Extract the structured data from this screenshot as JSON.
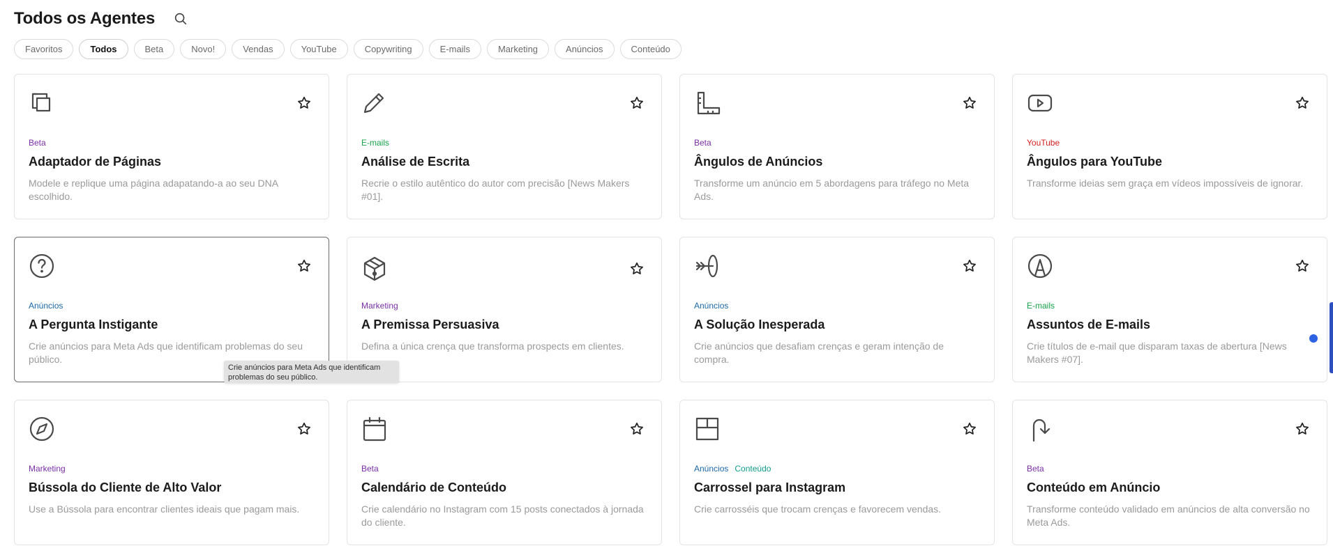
{
  "header": {
    "title": "Todos os Agentes"
  },
  "filters": [
    {
      "label": "Favoritos",
      "active": false
    },
    {
      "label": "Todos",
      "active": true
    },
    {
      "label": "Beta",
      "active": false
    },
    {
      "label": "Novo!",
      "active": false
    },
    {
      "label": "Vendas",
      "active": false
    },
    {
      "label": "YouTube",
      "active": false
    },
    {
      "label": "Copywriting",
      "active": false
    },
    {
      "label": "E-mails",
      "active": false
    },
    {
      "label": "Marketing",
      "active": false
    },
    {
      "label": "Anúncios",
      "active": false
    },
    {
      "label": "Conteúdo",
      "active": false
    }
  ],
  "tag_colors": {
    "Beta": "#7b2fa6",
    "E-mails": "#18a34a",
    "YouTube": "#d32020",
    "Anúncios": "#1c67a8",
    "Marketing": "#7b2fa6",
    "Conteúdo": "#129a8a"
  },
  "cards": [
    {
      "icon": "copy-icon",
      "tags": [
        "Beta"
      ],
      "title": "Adaptador de Páginas",
      "description": "Modele e replique uma página adapatando-a ao seu DNA escolhido."
    },
    {
      "icon": "pencil-icon",
      "tags": [
        "E-mails"
      ],
      "title": "Análise de Escrita",
      "description": "Recrie o estilo autêntico do autor com precisão [News Makers #01]."
    },
    {
      "icon": "ruler-icon",
      "tags": [
        "Beta"
      ],
      "title": "Ângulos de Anúncios",
      "description": "Transforme um anúncio em 5 abordagens para tráfego no Meta Ads."
    },
    {
      "icon": "youtube-icon",
      "tags": [
        "YouTube"
      ],
      "title": "Ângulos para YouTube",
      "description": "Transforme ideias sem graça em vídeos impossíveis de ignorar."
    },
    {
      "icon": "question-circle-icon",
      "tags": [
        "Anúncios"
      ],
      "title": "A Pergunta Instigante",
      "description": "Crie anúncios para Meta Ads que identificam problemas do seu público."
    },
    {
      "icon": "box-icon",
      "tags": [
        "Marketing"
      ],
      "title": "A Premissa Persuasiva",
      "description": "Defina a única crença que transforma prospects em clientes."
    },
    {
      "icon": "target-arrow-icon",
      "tags": [
        "Anúncios"
      ],
      "title": "A Solução Inesperada",
      "description": "Crie anúncios que desafiam crenças e geram intenção de compra."
    },
    {
      "icon": "letter-a-circle-icon",
      "tags": [
        "E-mails"
      ],
      "title": "Assuntos de E-mails",
      "description": "Crie títulos de e-mail que disparam taxas de abertura [News Makers #07]."
    },
    {
      "icon": "compass-icon",
      "tags": [
        "Marketing"
      ],
      "title": "Bússola do Cliente de Alto Valor",
      "description": "Use a Bússola para encontrar clientes ideais que pagam mais."
    },
    {
      "icon": "calendar-icon",
      "tags": [
        "Beta"
      ],
      "title": "Calendário de Conteúdo",
      "description": "Crie calendário no Instagram com 15 posts conectados à jornada do cliente."
    },
    {
      "icon": "layout-grid-icon",
      "tags": [
        "Anúncios",
        "Conteúdo"
      ],
      "title": "Carrossel para Instagram",
      "description": "Crie carrosséis que trocam crenças e favorecem vendas."
    },
    {
      "icon": "arrow-up-bend-icon",
      "tags": [
        "Beta"
      ],
      "title": "Conteúdo em Anúncio",
      "description": "Transforme conteúdo validado em anúncios de alta conversão no Meta Ads."
    }
  ],
  "tooltip": {
    "text": "Crie anúncios para Meta Ads que identificam problemas do seu público."
  }
}
